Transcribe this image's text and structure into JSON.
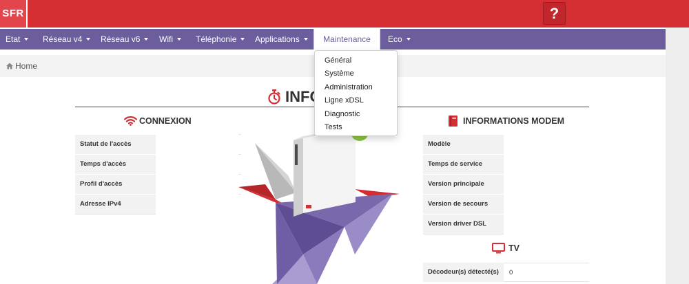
{
  "brand": {
    "logo_text": "SFR",
    "help_label": "?",
    "primary_color": "#d42e33",
    "nav_color": "#6c5e9c"
  },
  "nav": {
    "items": [
      {
        "label": "Etat",
        "has_caret": true
      },
      {
        "label": "Réseau v4",
        "has_caret": true
      },
      {
        "label": "Réseau v6",
        "has_caret": true
      },
      {
        "label": "Wifi",
        "has_caret": true
      },
      {
        "label": "Téléphonie",
        "has_caret": true
      },
      {
        "label": "Applications",
        "has_caret": true
      },
      {
        "label": "Maintenance",
        "has_caret": false,
        "active": true
      },
      {
        "label": "Eco",
        "has_caret": true
      }
    ]
  },
  "dropdown": {
    "items": [
      "Général",
      "Système",
      "Administration",
      "Ligne xDSL",
      "Diagnostic",
      "Tests"
    ]
  },
  "breadcrumb": {
    "home": "Home"
  },
  "page": {
    "title": "INFO"
  },
  "connexion": {
    "title": "CONNEXION",
    "icon": "wifi-icon",
    "rows": [
      {
        "label": "Statut de l'accès",
        "value": ""
      },
      {
        "label": "Temps d'accès",
        "value": ""
      },
      {
        "label": "Profil d'accès",
        "value": ""
      },
      {
        "label": "Adresse IPv4",
        "value": ""
      }
    ]
  },
  "modem": {
    "title": "INFORMATIONS MODEM",
    "icon": "book-icon",
    "rows": [
      {
        "label": "Modèle",
        "value": ""
      },
      {
        "label": "Temps de service",
        "value": ""
      },
      {
        "label": "Version principale",
        "value": ""
      },
      {
        "label": "Version de secours",
        "value": ""
      },
      {
        "label": "Version driver DSL",
        "value": ""
      }
    ]
  },
  "tv": {
    "title": "TV",
    "icon": "monitor-icon",
    "rows": [
      {
        "label": "Décodeur(s) détecté(s)",
        "value": "0"
      }
    ]
  }
}
